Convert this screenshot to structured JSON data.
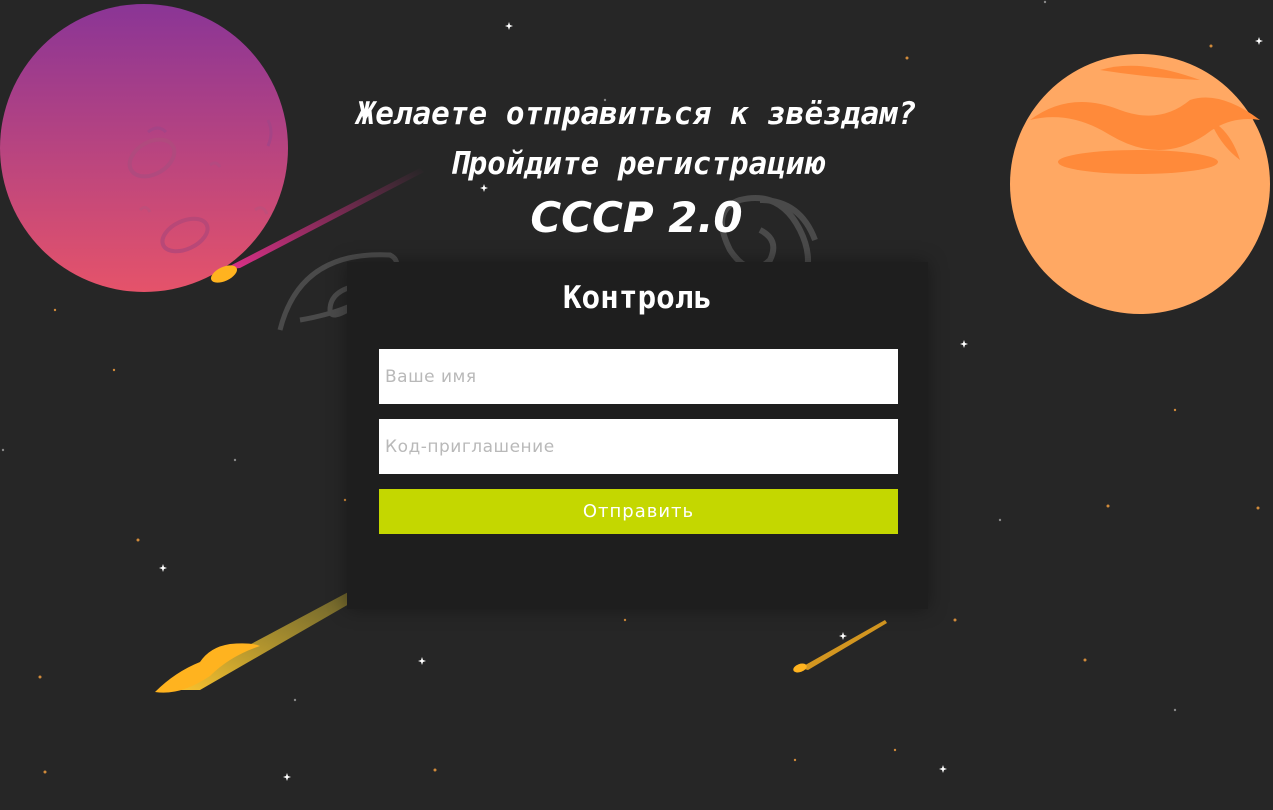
{
  "heading": {
    "line1": "Желаете отправиться к звёздам?",
    "line2": "Пройдите регистрацию",
    "line3": "СССР 2.0"
  },
  "form": {
    "title": "Контроль",
    "name_placeholder": "Ваше имя",
    "code_placeholder": "Код-приглашение",
    "submit_label": "Отправить"
  },
  "colors": {
    "background": "#262626",
    "panel": "#1e1e1e",
    "submit": "#c4d700",
    "planet_left_top": "#8a3a9a",
    "planet_left_bottom": "#e0506a",
    "planet_right": "#ffa863",
    "comet": "#ffb31f"
  },
  "icons": [
    "purple-planet-icon",
    "orange-planet-icon",
    "spiral-galaxy-icon",
    "comet-icon",
    "star-icon"
  ]
}
